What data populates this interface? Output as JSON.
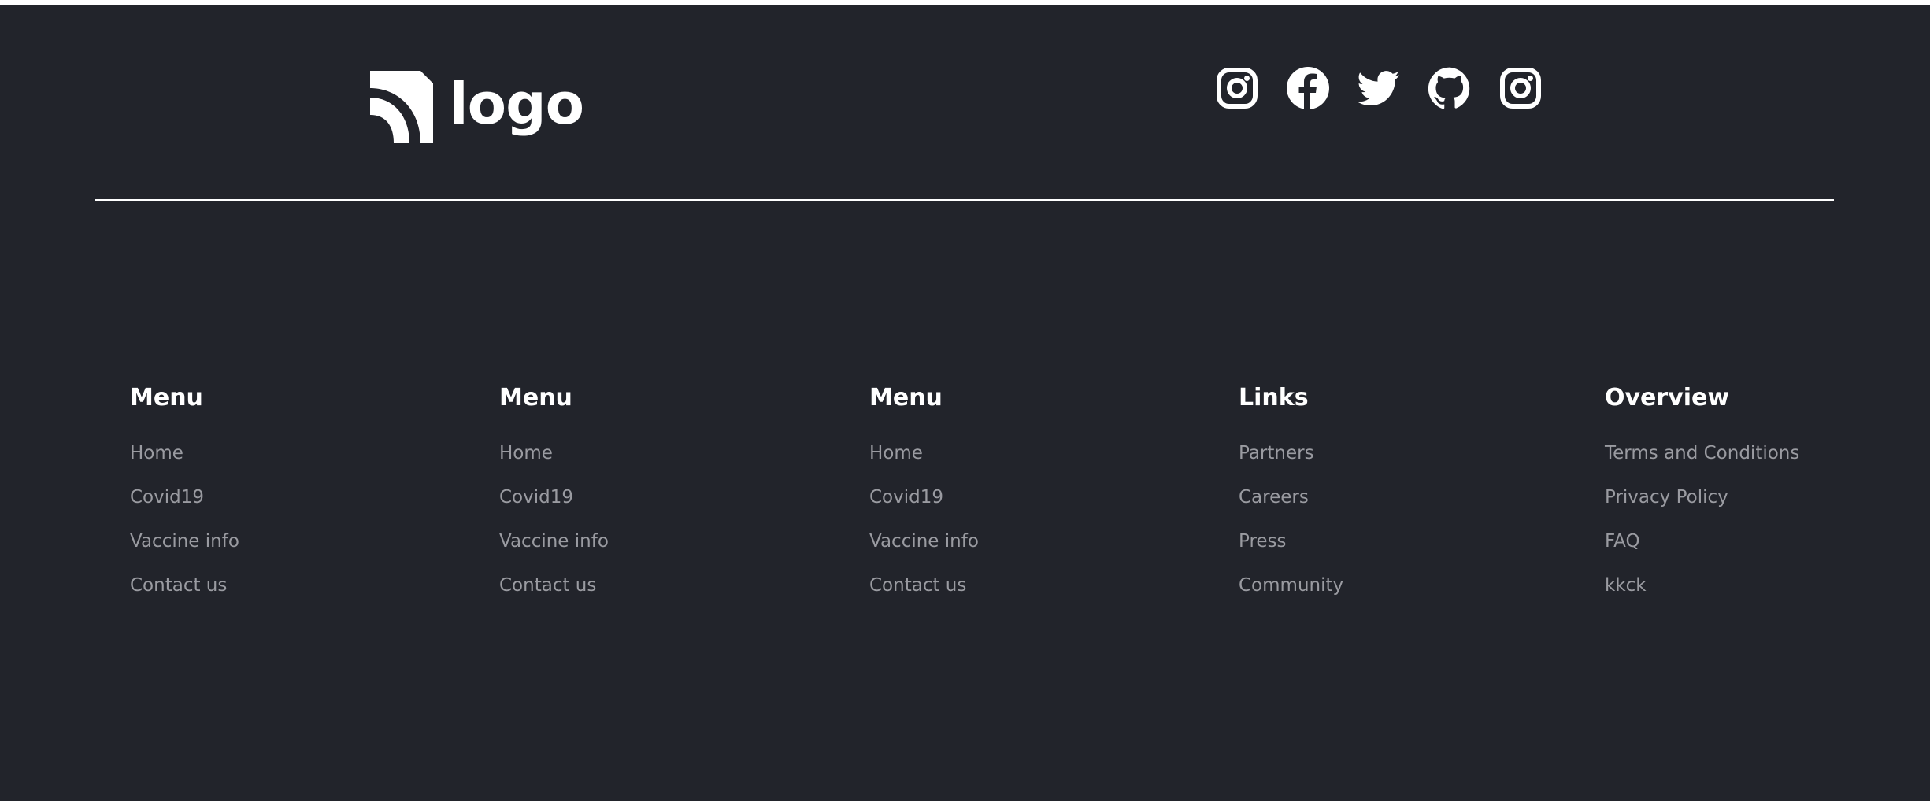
{
  "brand": {
    "logo_text": "logo",
    "logo_icon": "rss-quarter-arcs-icon"
  },
  "socials": [
    {
      "icon": "instagram-icon"
    },
    {
      "icon": "facebook-icon"
    },
    {
      "icon": "twitter-icon"
    },
    {
      "icon": "github-icon"
    },
    {
      "icon": "instagram-icon"
    }
  ],
  "columns": [
    {
      "title": "Menu",
      "links": [
        "Home",
        "Covid19",
        "Vaccine info",
        "Contact us"
      ]
    },
    {
      "title": "Menu",
      "links": [
        "Home",
        "Covid19",
        "Vaccine info",
        "Contact us"
      ]
    },
    {
      "title": "Menu",
      "links": [
        "Home",
        "Covid19",
        "Vaccine info",
        "Contact us"
      ]
    },
    {
      "title": "Links",
      "links": [
        "Partners",
        "Careers",
        "Press",
        "Community"
      ]
    },
    {
      "title": "Overview",
      "links": [
        "Terms and Conditions",
        "Privacy Policy",
        "FAQ",
        "kkck"
      ]
    }
  ],
  "colors": {
    "footer_bg": "#22242b",
    "heading": "#ffffff",
    "link": "#9a9ba1",
    "divider": "#ffffff"
  }
}
